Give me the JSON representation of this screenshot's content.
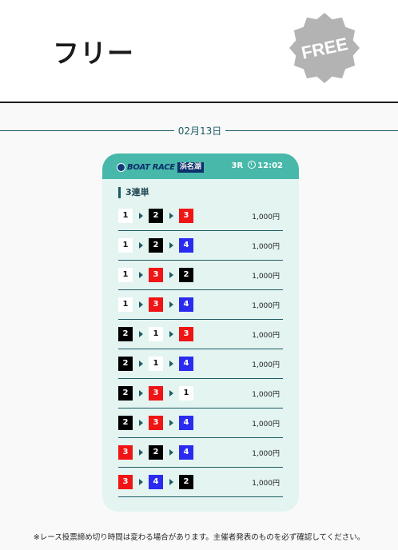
{
  "header": {
    "title": "フリー",
    "badge": "FREE"
  },
  "date": "02月13日",
  "card": {
    "logo_brand": "BOAT RACE",
    "logo_venue": "浜名湖",
    "race": "3R",
    "time": "12:02",
    "bet_type": "3連単",
    "boat_colors": {
      "1": {
        "bg": "#ffffff",
        "fg": "#111111"
      },
      "2": {
        "bg": "#000000",
        "fg": "#ffffff"
      },
      "3": {
        "bg": "#f01414",
        "fg": "#ffffff"
      },
      "4": {
        "bg": "#2b2bf0",
        "fg": "#ffffff"
      }
    },
    "rows": [
      {
        "combo": [
          "1",
          "2",
          "3"
        ],
        "amount": "1,000円"
      },
      {
        "combo": [
          "1",
          "2",
          "4"
        ],
        "amount": "1,000円"
      },
      {
        "combo": [
          "1",
          "3",
          "2"
        ],
        "amount": "1,000円"
      },
      {
        "combo": [
          "1",
          "3",
          "4"
        ],
        "amount": "1,000円"
      },
      {
        "combo": [
          "2",
          "1",
          "3"
        ],
        "amount": "1,000円"
      },
      {
        "combo": [
          "2",
          "1",
          "4"
        ],
        "amount": "1,000円"
      },
      {
        "combo": [
          "2",
          "3",
          "1"
        ],
        "amount": "1,000円"
      },
      {
        "combo": [
          "2",
          "3",
          "4"
        ],
        "amount": "1,000円"
      },
      {
        "combo": [
          "3",
          "2",
          "4"
        ],
        "amount": "1,000円"
      },
      {
        "combo": [
          "3",
          "4",
          "2"
        ],
        "amount": "1,000円"
      }
    ]
  },
  "footnote": "※レース投票締め切り時間は変わる場合があります。主催者発表のものを必ず確認してください。"
}
